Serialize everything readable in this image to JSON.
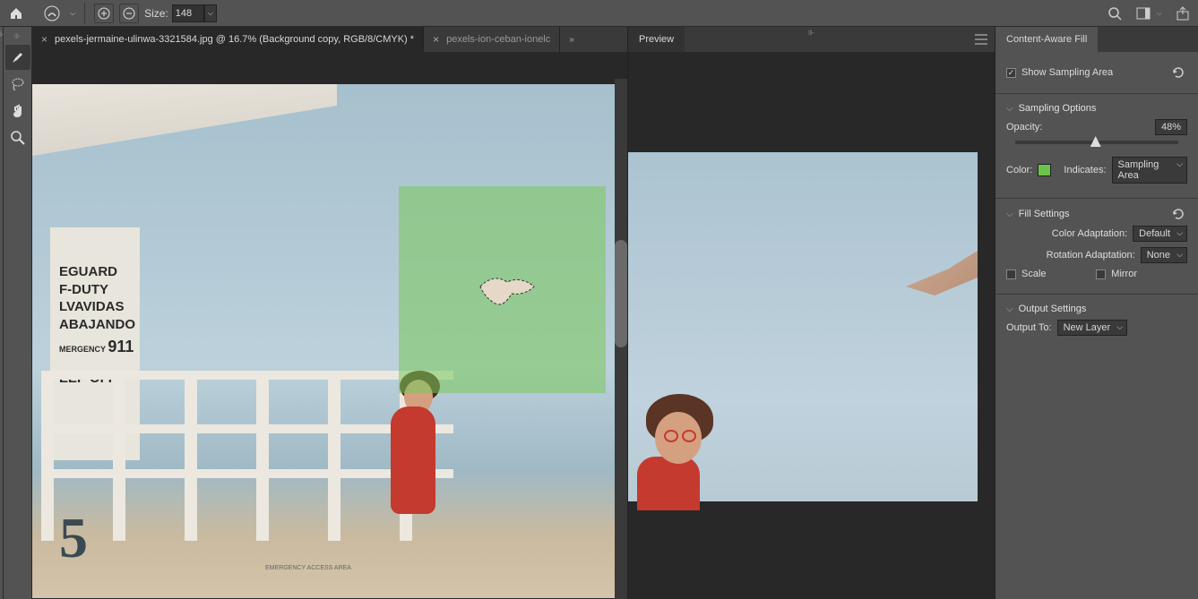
{
  "topbar": {
    "size_label": "Size:",
    "size_value": "148"
  },
  "tabs": [
    {
      "close": "×",
      "title": "pexels-jermaine-ulinwa-3321584.jpg @ 16.7% (Background copy, RGB/8/CMYK) *"
    },
    {
      "close": "×",
      "title": "pexels-ion-ceban-ionelc"
    }
  ],
  "canvas": {
    "wall_text_lines": [
      "EGUARD",
      "F-DUTY",
      "LVAVIDAS",
      "ABAJANDO",
      "MERGENCY",
      "911",
      "EEP OFF"
    ],
    "big_number": "5",
    "access_sign": "EMERGENCY ACCESS AREA"
  },
  "preview": {
    "tab": "Preview"
  },
  "panel": {
    "title": "Content-Aware Fill",
    "show_sampling": "Show Sampling Area",
    "section_sampling": "Sampling Options",
    "opacity_label": "Opacity:",
    "opacity_value": "48%",
    "opacity_pct": 48,
    "color_label": "Color:",
    "color_swatch": "#6bc44a",
    "indicates_label": "Indicates:",
    "indicates_value": "Sampling Area",
    "section_fill": "Fill Settings",
    "color_adapt_label": "Color Adaptation:",
    "color_adapt_value": "Default",
    "rotation_adapt_label": "Rotation Adaptation:",
    "rotation_adapt_value": "None",
    "scale_label": "Scale",
    "mirror_label": "Mirror",
    "section_output": "Output Settings",
    "output_to_label": "Output To:",
    "output_to_value": "New Layer"
  }
}
